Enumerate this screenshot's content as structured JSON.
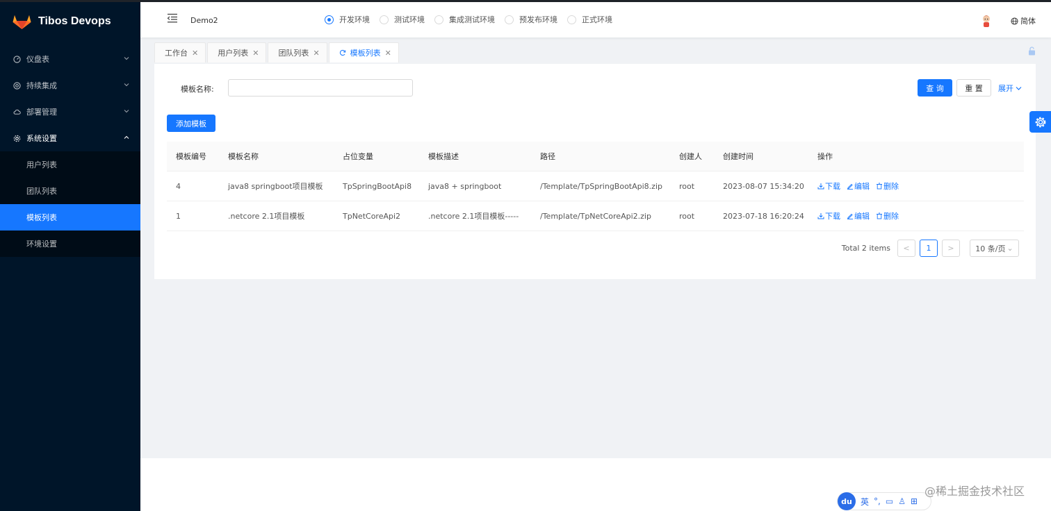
{
  "app": {
    "title": "Tibos Devops"
  },
  "sidebar": {
    "items": [
      {
        "label": "仪盘表",
        "icon": "dashboard-icon"
      },
      {
        "label": "持续集成",
        "icon": "integration-icon"
      },
      {
        "label": "部署管理",
        "icon": "cloud-icon"
      },
      {
        "label": "系统设置",
        "icon": "gear-icon"
      }
    ],
    "sub_items": [
      {
        "label": "用户列表"
      },
      {
        "label": "团队列表"
      },
      {
        "label": "模板列表"
      },
      {
        "label": "环境设置"
      }
    ]
  },
  "header": {
    "project": "Demo2",
    "envs": [
      "开发环境",
      "测试环境",
      "集成测试环境",
      "预发布环境",
      "正式环境"
    ],
    "selected_env": "开发环境",
    "lang": "简体"
  },
  "tabs": [
    {
      "label": "工作台"
    },
    {
      "label": "用户列表"
    },
    {
      "label": "团队列表"
    },
    {
      "label": "模板列表"
    }
  ],
  "search": {
    "label": "模板名称:",
    "value": "",
    "query": "查 询",
    "reset": "重 置",
    "expand": "展开"
  },
  "add_button": "添加模板",
  "table": {
    "columns": [
      "模板编号",
      "模板名称",
      "占位变量",
      "模板描述",
      "路径",
      "创建人",
      "创建时间",
      "操作"
    ],
    "rows": [
      {
        "id": "4",
        "name": "java8 springboot项目模板",
        "var": "TpSpringBootApi8",
        "desc": "java8 + springboot",
        "path": "/Template/TpSpringBootApi8.zip",
        "creator": "root",
        "time": "2023-08-07 15:34:20"
      },
      {
        "id": "1",
        "name": ".netcore 2.1项目模板",
        "var": "TpNetCoreApi2",
        "desc": ".netcore 2.1项目模板-----",
        "path": "/Template/TpNetCoreApi2.zip",
        "creator": "root",
        "time": "2023-07-18 16:20:24"
      }
    ],
    "actions": {
      "download": "下载",
      "edit": "编辑",
      "delete": "删除"
    }
  },
  "pagination": {
    "total": "Total 2 items",
    "current": "1",
    "prev": "<",
    "next": ">",
    "page_size": "10 条/页"
  },
  "ime": {
    "du": "du",
    "lang": "英"
  },
  "watermark": "@稀土掘金技术社区",
  "colors": {
    "primary": "#1677ff",
    "sider": "#001529"
  }
}
